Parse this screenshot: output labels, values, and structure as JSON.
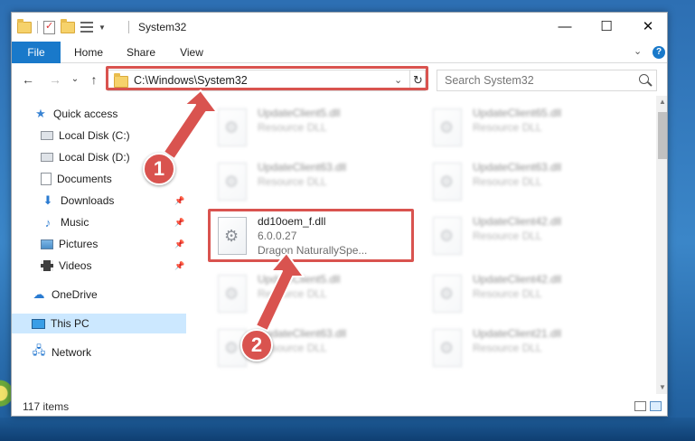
{
  "window": {
    "title": "System32",
    "controls": {
      "minimize": "—",
      "maximize": "☐",
      "close": "✕"
    }
  },
  "ribbon": {
    "tabs": [
      "File",
      "Home",
      "Share",
      "View"
    ],
    "help": "?"
  },
  "navigation": {
    "back": "←",
    "forward": "→",
    "recent": "⌄",
    "up": "↑",
    "address": "C:\\Windows\\System32",
    "refresh": "↻",
    "search_placeholder": "Search System32"
  },
  "sidebar": {
    "items": [
      {
        "label": "Quick access",
        "icon": "star-icon"
      },
      {
        "label": "Local Disk (C:)",
        "icon": "drive-icon"
      },
      {
        "label": "Local Disk (D:)",
        "icon": "drive-icon"
      },
      {
        "label": "Documents",
        "icon": "document-icon"
      },
      {
        "label": "Downloads",
        "icon": "download-icon",
        "pinned": true
      },
      {
        "label": "Music",
        "icon": "music-icon",
        "pinned": true
      },
      {
        "label": "Pictures",
        "icon": "pictures-icon",
        "pinned": true
      },
      {
        "label": "Videos",
        "icon": "videos-icon",
        "pinned": true
      },
      {
        "label": "OneDrive",
        "icon": "cloud-icon"
      },
      {
        "label": "This PC",
        "icon": "computer-icon",
        "selected": true
      },
      {
        "label": "Network",
        "icon": "network-icon"
      }
    ]
  },
  "files": {
    "left": [
      {
        "name": "UpdateClient5.dll",
        "type": "Resource DLL"
      },
      {
        "name": "UpdateClient63.dll",
        "type": "Resource DLL"
      },
      {
        "name": "dd10oem_f.dll",
        "version": "6.0.0.27",
        "company": "Dragon NaturallySpe..."
      },
      {
        "name": "UpdateClient5.dll",
        "type": "Resource DLL"
      },
      {
        "name": "UpdateClient63.dll",
        "type": "Resource DLL"
      }
    ],
    "right": [
      {
        "name": "UpdateClient65.dll",
        "type": "Resource DLL"
      },
      {
        "name": "UpdateClient63.dll",
        "type": "Resource DLL"
      },
      {
        "name": "UpdateClient42.dll",
        "type": "Resource DLL"
      },
      {
        "name": "UpdateClient42.dll",
        "type": "Resource DLL"
      },
      {
        "name": "UpdateClient21.dll",
        "type": "Resource DLL"
      }
    ]
  },
  "status": {
    "item_count": "117 items"
  },
  "annotations": {
    "step1": "1",
    "step2": "2",
    "color": "#d9534f"
  },
  "colors": {
    "accent": "#1979ca",
    "selected": "#cce8ff",
    "highlight": "#d9534f"
  }
}
